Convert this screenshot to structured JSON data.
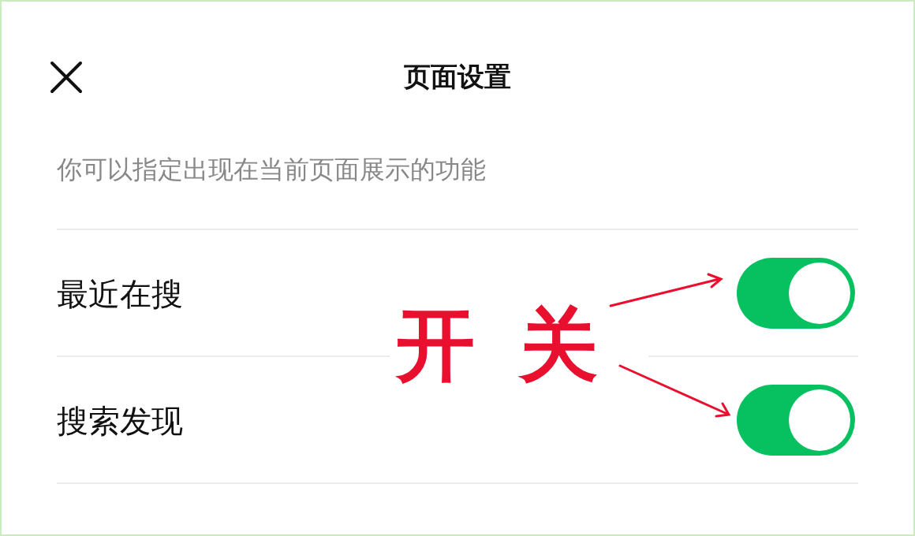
{
  "header": {
    "title": "页面设置"
  },
  "description": "你可以指定出现在当前页面展示的功能",
  "settings": [
    {
      "label": "最近在搜",
      "on": true
    },
    {
      "label": "搜索发现",
      "on": true
    }
  ],
  "annotation": {
    "text": "开关"
  }
}
